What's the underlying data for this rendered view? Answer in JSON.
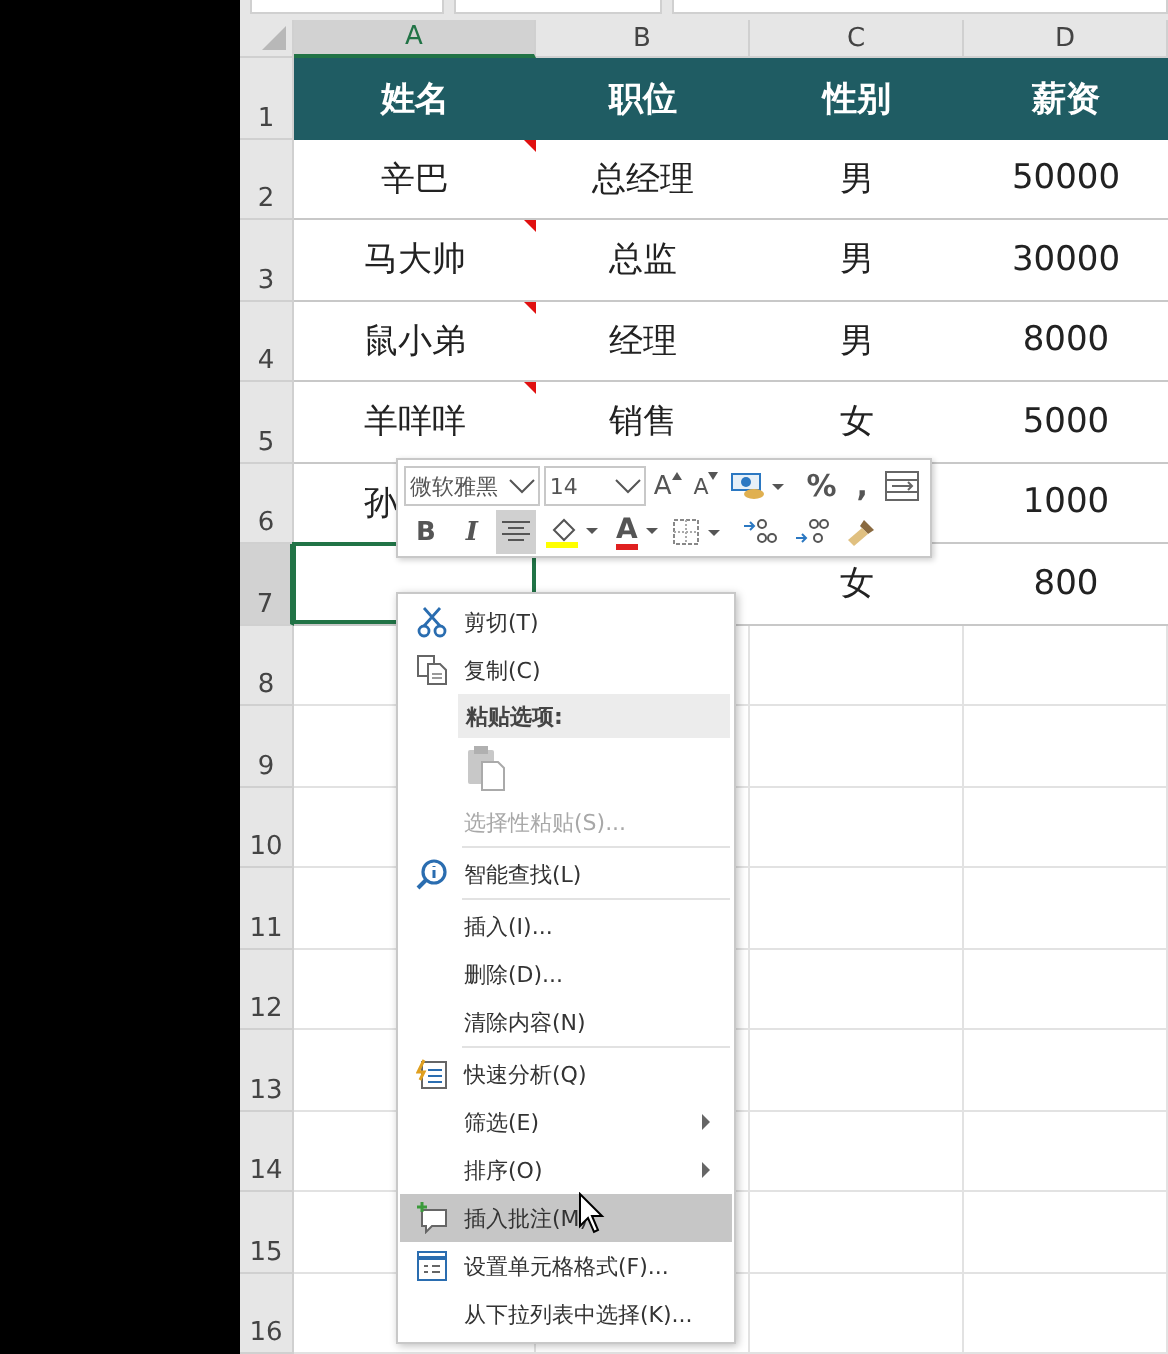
{
  "columns": [
    {
      "label": "A",
      "selected": true
    },
    {
      "label": "B",
      "selected": false
    },
    {
      "label": "C",
      "selected": false
    },
    {
      "label": "D",
      "selected": false
    }
  ],
  "rows": [
    {
      "number": "1",
      "selected": false,
      "kind": "header",
      "cells": [
        {
          "text": "姓名",
          "comment": false
        },
        {
          "text": "职位",
          "comment": false
        },
        {
          "text": "性别",
          "comment": false
        },
        {
          "text": "薪资",
          "comment": false
        }
      ]
    },
    {
      "number": "2",
      "selected": false,
      "kind": "data",
      "cells": [
        {
          "text": "辛巴",
          "comment": true
        },
        {
          "text": "总经理",
          "comment": false
        },
        {
          "text": "男",
          "comment": false
        },
        {
          "text": "50000",
          "comment": false
        }
      ]
    },
    {
      "number": "3",
      "selected": false,
      "kind": "data",
      "cells": [
        {
          "text": "马大帅",
          "comment": true
        },
        {
          "text": "总监",
          "comment": false
        },
        {
          "text": "男",
          "comment": false
        },
        {
          "text": "30000",
          "comment": false
        }
      ]
    },
    {
      "number": "4",
      "selected": false,
      "kind": "data",
      "cells": [
        {
          "text": "鼠小弟",
          "comment": true
        },
        {
          "text": "经理",
          "comment": false
        },
        {
          "text": "男",
          "comment": false
        },
        {
          "text": "8000",
          "comment": false
        }
      ]
    },
    {
      "number": "5",
      "selected": false,
      "kind": "data",
      "cells": [
        {
          "text": "羊咩咩",
          "comment": true
        },
        {
          "text": "销售",
          "comment": false
        },
        {
          "text": "女",
          "comment": false
        },
        {
          "text": "5000",
          "comment": false
        }
      ]
    },
    {
      "number": "6",
      "selected": false,
      "kind": "data",
      "cells": [
        {
          "text": "孙"
        },
        {},
        {},
        {
          "text": "1000",
          "comment": false
        }
      ]
    },
    {
      "number": "7",
      "selected": true,
      "kind": "data",
      "cells": [
        {
          "comment": false
        },
        {},
        {
          "text": "女",
          "comment": false
        },
        {
          "text": "800",
          "comment": false
        }
      ]
    },
    {
      "number": "8",
      "selected": false,
      "kind": "empty"
    },
    {
      "number": "9",
      "selected": false,
      "kind": "empty"
    },
    {
      "number": "10",
      "selected": false,
      "kind": "empty"
    },
    {
      "number": "11",
      "selected": false,
      "kind": "empty"
    },
    {
      "number": "12",
      "selected": false,
      "kind": "empty"
    },
    {
      "number": "13",
      "selected": false,
      "kind": "empty"
    },
    {
      "number": "14",
      "selected": false,
      "kind": "empty"
    },
    {
      "number": "15",
      "selected": false,
      "kind": "empty"
    },
    {
      "number": "16",
      "selected": false,
      "kind": "empty"
    }
  ],
  "mini_toolbar": {
    "font": {
      "value": "微软雅黑"
    },
    "size": {
      "value": "14"
    },
    "row_1": [
      {
        "kind": "grow",
        "label": "A"
      },
      {
        "kind": "shrink",
        "label": "A"
      },
      {
        "kind": "accounting"
      },
      {
        "kind": "text",
        "label": "%"
      },
      {
        "kind": "text",
        "label": ","
      },
      {
        "kind": "wrap"
      }
    ],
    "row_2": [
      {
        "kind": "bold",
        "label": "B",
        "selected": false
      },
      {
        "kind": "italic",
        "label": "I",
        "selected": false
      },
      {
        "kind": "align",
        "selected": true
      },
      {
        "kind": "fill",
        "color": "#ffff00"
      },
      {
        "kind": "fontcolor",
        "label": "A",
        "color": "#e02020"
      },
      {
        "kind": "borders"
      },
      {
        "kind": "increase-decimal"
      },
      {
        "kind": "decrease-decimal"
      },
      {
        "kind": "painter"
      }
    ]
  },
  "context_menu": [
    {
      "kind": "item",
      "label": "剪切(T)",
      "selected": false,
      "disabled": false,
      "submenu": false
    },
    {
      "kind": "item",
      "label": "复制(C)",
      "selected": false,
      "disabled": false,
      "submenu": false
    },
    {
      "kind": "header",
      "label": "粘贴选项:"
    },
    {
      "kind": "paste-options"
    },
    {
      "kind": "item",
      "label": "选择性粘贴(S)...",
      "selected": false,
      "disabled": true,
      "submenu": false
    },
    {
      "kind": "separator"
    },
    {
      "kind": "item",
      "label": "智能查找(L)",
      "selected": false,
      "disabled": false,
      "submenu": false
    },
    {
      "kind": "separator"
    },
    {
      "kind": "item",
      "label": "插入(I)...",
      "selected": false,
      "disabled": false,
      "submenu": false
    },
    {
      "kind": "item",
      "label": "删除(D)...",
      "selected": false,
      "disabled": false,
      "submenu": false
    },
    {
      "kind": "item",
      "label": "清除内容(N)",
      "selected": false,
      "disabled": false,
      "submenu": false
    },
    {
      "kind": "separator"
    },
    {
      "kind": "item",
      "label": "快速分析(Q)",
      "selected": false,
      "disabled": false,
      "submenu": false
    },
    {
      "kind": "item",
      "label": "筛选(E)",
      "selected": false,
      "disabled": false,
      "submenu": true
    },
    {
      "kind": "item",
      "label": "排序(O)",
      "selected": false,
      "disabled": false,
      "submenu": true
    },
    {
      "kind": "item",
      "label": "插入批注(M)",
      "selected": true,
      "disabled": false,
      "submenu": false
    },
    {
      "kind": "item",
      "label": "设置单元格格式(F)...",
      "selected": false,
      "disabled": false,
      "submenu": false
    },
    {
      "kind": "item",
      "label": "从下拉列表中选择(K)...",
      "selected": false,
      "disabled": false,
      "submenu": false
    }
  ]
}
